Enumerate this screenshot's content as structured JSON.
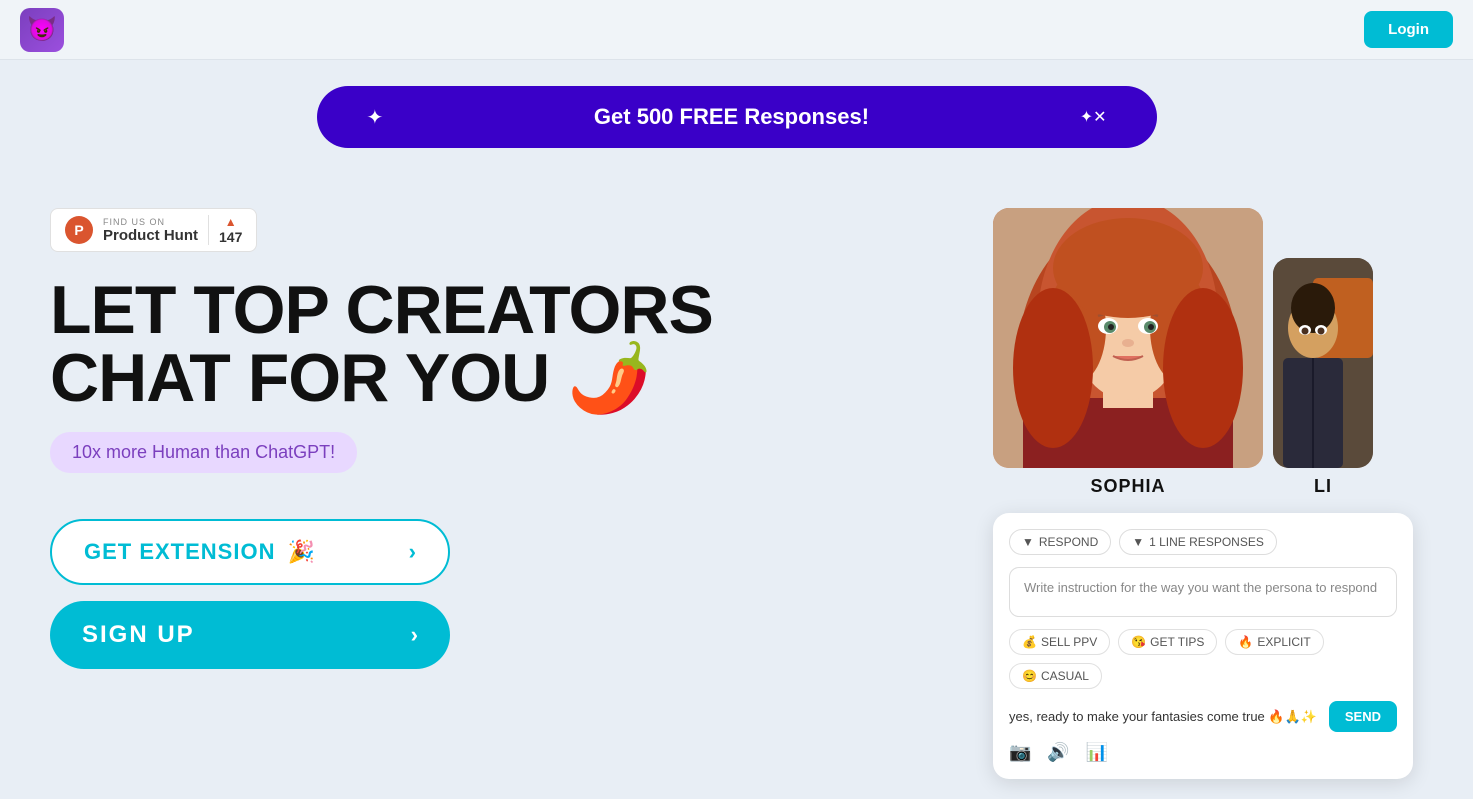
{
  "header": {
    "logo_emoji": "😈",
    "login_label": "Login"
  },
  "banner": {
    "text": "Get 500 FREE Responses!",
    "icon_left": "✦",
    "icon_close": "✦✕"
  },
  "product_hunt": {
    "find_us_on": "FIND US ON",
    "name": "Product Hunt",
    "votes": "147",
    "p_letter": "P"
  },
  "hero": {
    "line1": "LET TOP CREATORS",
    "line2": "CHAT FOR YOU 🌶️"
  },
  "subtitle": "10x more Human than ChatGPT!",
  "buttons": {
    "get_extension": "GET EXTENSION",
    "get_extension_emoji": "🎉",
    "sign_up": "SIGN UP"
  },
  "creators": [
    {
      "name": "SOPHIA"
    },
    {
      "name": "LI"
    }
  ],
  "chat_widget": {
    "respond_btn": "RESPOND",
    "responses_btn": "1 LINE RESPONSES",
    "input_placeholder": "Write instruction for the way you want the persona to respond",
    "tags": [
      {
        "emoji": "💰",
        "label": "SELL PPV"
      },
      {
        "emoji": "😘",
        "label": "GET TIPS"
      },
      {
        "emoji": "🔥",
        "label": "EXPLICIT"
      },
      {
        "emoji": "😊",
        "label": "CASUAL"
      }
    ],
    "message": "yes, ready to make your fantasies come true 🔥🙏✨",
    "send_label": "SEND",
    "bottom_icons": [
      "📷",
      "🔊",
      "📊"
    ]
  }
}
